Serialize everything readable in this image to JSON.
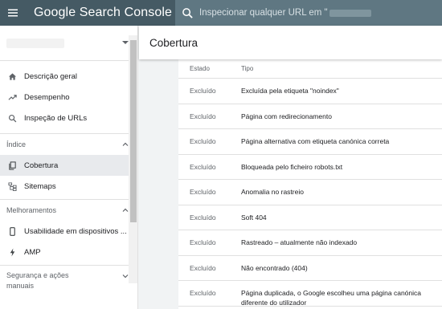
{
  "header": {
    "logo_text": "Google Search Console",
    "search_placeholder": "Inspecionar qualquer URL em \"",
    "colors": {
      "topbar": "#455a64",
      "search": "#5f7782"
    }
  },
  "sidebar": {
    "items": [
      {
        "label": "Descrição geral",
        "icon": "home-icon"
      },
      {
        "label": "Desempenho",
        "icon": "trending-up-icon"
      },
      {
        "label": "Inspeção de URLs",
        "icon": "search-icon"
      }
    ],
    "section_index": "Índice",
    "index_items": [
      {
        "label": "Cobertura",
        "icon": "coverage-icon",
        "active": true
      },
      {
        "label": "Sitemaps",
        "icon": "sitemap-icon"
      }
    ],
    "section_enhancements": "Melhoramentos",
    "enh_items": [
      {
        "label": "Usabilidade em dispositivos ...",
        "icon": "mobile-icon"
      },
      {
        "label": "AMP",
        "icon": "bolt-icon"
      }
    ],
    "section_security": "Segurança e ações manuais"
  },
  "page": {
    "title": "Cobertura"
  },
  "table": {
    "headers": [
      "Estado",
      "Tipo"
    ],
    "rows": [
      [
        "Excluído",
        "Excluída pela etiqueta \"noindex\""
      ],
      [
        "Excluído",
        "Página com redirecionamento"
      ],
      [
        "Excluído",
        "Página alternativa com etiqueta canónica correta"
      ],
      [
        "Excluído",
        "Bloqueada pelo ficheiro robots.txt"
      ],
      [
        "Excluído",
        "Anomalia no rastreio"
      ],
      [
        "Excluído",
        "Soft 404"
      ],
      [
        "Excluído",
        "Rastreado – atualmente não indexado"
      ],
      [
        "Excluído",
        "Não encontrado (404)"
      ],
      [
        "Excluído",
        "Página duplicada, o Google escolheu uma página canónica diferente do utilizador"
      ]
    ]
  }
}
